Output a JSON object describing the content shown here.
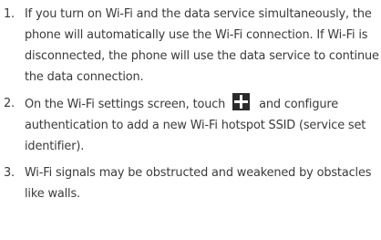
{
  "items": [
    {
      "number": "1.",
      "text": "If you turn on Wi-Fi and the data service simultaneously, the phone will automatically use the Wi-Fi connection. If Wi-Fi is disconnected, the phone will use the data service to continue the data connection."
    },
    {
      "number": "2.",
      "text_before": "On the Wi-Fi settings screen, touch",
      "icon": "plus-icon",
      "text_after": "and configure authentication to add a new Wi-Fi hotspot SSID (service set identifier)."
    },
    {
      "number": "3.",
      "text": "Wi-Fi signals may be obstructed and weakened by obstacles like walls."
    }
  ]
}
